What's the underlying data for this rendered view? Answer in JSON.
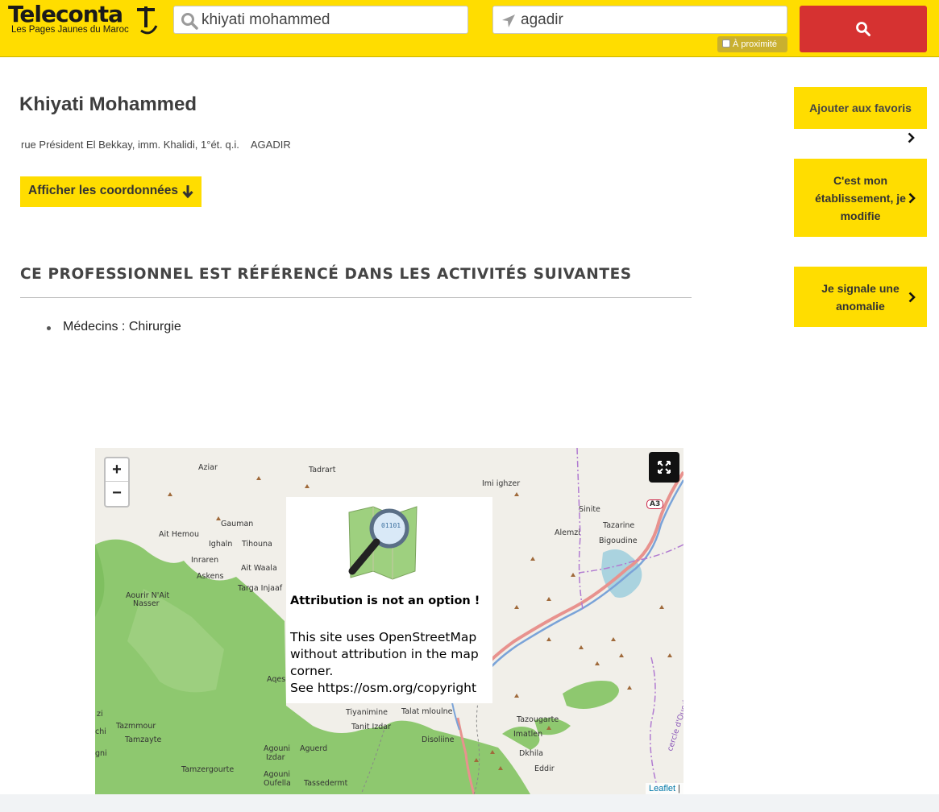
{
  "header": {
    "logo_text": "Teleconta",
    "logo_tagline": "Les Pages Jaunes du Maroc",
    "what_value": "khiyati mohammed",
    "where_value": "agadir",
    "proximity_label": "À proximité",
    "proximity_checked": false,
    "icons": {
      "search": "search-icon",
      "location": "location-arrow-icon",
      "submit": "search-icon"
    },
    "colors": {
      "brand_yellow": "#ffdd00",
      "submit_red": "#d63231"
    }
  },
  "listing": {
    "name": "Khiyati Mohammed",
    "street": "rue Président El Bekkay, imm. Khalidi, 1°ét. q.i.",
    "city": "AGADIR",
    "show_contact_label": "Afficher les coordonnées"
  },
  "activities": {
    "heading": "CE PROFESSIONNEL EST RÉFÉRENCÉ DANS LES ACTIVITÉS SUIVANTES",
    "items": [
      "Médecins : Chirurgie"
    ]
  },
  "sidebar": {
    "favorites_label": "Ajouter aux favoris",
    "owner_label": "C'est mon établissement, je modifie",
    "report_label": "Je signale une anomalie"
  },
  "map": {
    "zoom_in": "+",
    "zoom_out": "−",
    "places": [
      "Aziar",
      "Tadrart",
      "Imi ighzer",
      "Sinite",
      "Tazarine",
      "Gauman",
      "Ait Hemou",
      "Alemzi",
      "Bigoudine",
      "Ighaln",
      "Tihouna",
      "Inraren",
      "Ait Waala",
      "Askens",
      "Targa Injaaf",
      "Aourir N'Ait",
      "Nasser",
      "Aqes",
      "Tiyanimine",
      "Talat mloulne",
      "Tazougarte",
      "Tazmmour",
      "Tamzayte",
      "Tanit Izdar",
      "Disoliine",
      "Imatlen",
      "Agouni",
      "Izdar",
      "Aguerd",
      "Dkhila",
      "Eddir",
      "Tamzergourte",
      "Agouni",
      "Oufella",
      "Tassedermt",
      "zi",
      "chi",
      "gni",
      "cercle d'Oued Teima",
      "A3"
    ],
    "notice_heading": "Attribution is not an option !",
    "notice_body_1": "This site uses OpenStreetMap without attribution in the map corner.",
    "notice_body_2": "See https://osm.org/copyright",
    "attribution_link": "Leaflet",
    "attribution_sep": " |"
  }
}
